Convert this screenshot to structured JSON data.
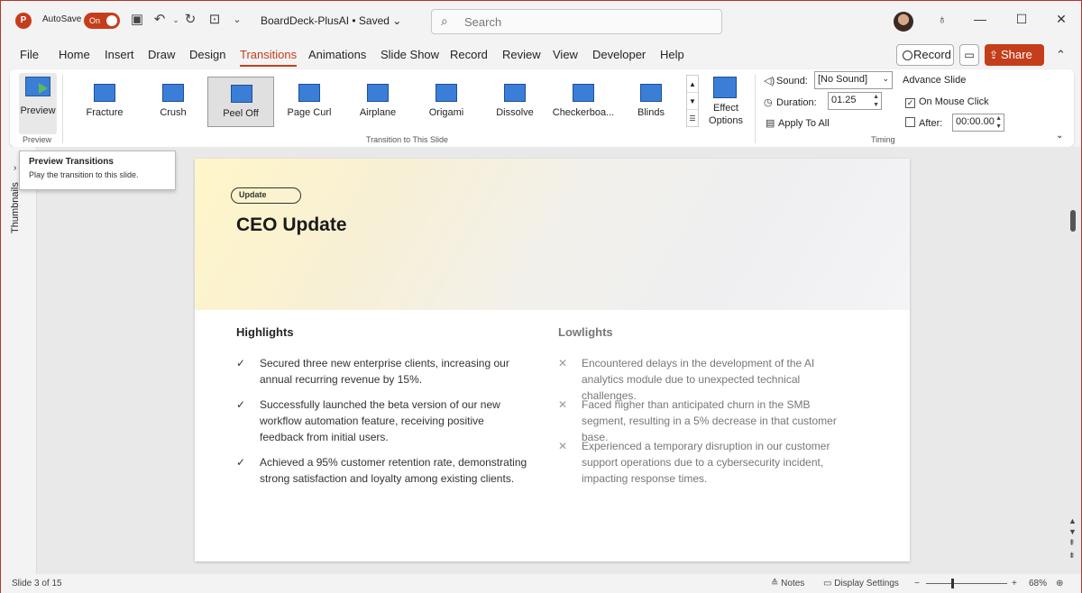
{
  "titlebar": {
    "app_icon": "P",
    "autosave_label": "AutoSave",
    "autosave_state": "On",
    "doc_title": "BoardDeck-PlusAI • Saved ⌄",
    "search_placeholder": "Search",
    "icons": [
      "save-icon",
      "undo-icon",
      "redo-icon",
      "present-icon",
      "customize-icon"
    ]
  },
  "menu": {
    "items": [
      "File",
      "Home",
      "Insert",
      "Draw",
      "Design",
      "Transitions",
      "Animations",
      "Slide Show",
      "Record",
      "Review",
      "View",
      "Developer",
      "Help"
    ],
    "active": "Transitions",
    "record_label": "Record",
    "share_label": "Share"
  },
  "ribbon": {
    "preview_label": "Preview",
    "preview_group": "Preview",
    "transitions_group": "Transition to This Slide",
    "gallery": [
      {
        "label": "Fracture"
      },
      {
        "label": "Crush"
      },
      {
        "label": "Peel Off"
      },
      {
        "label": "Page Curl"
      },
      {
        "label": "Airplane"
      },
      {
        "label": "Origami"
      },
      {
        "label": "Dissolve"
      },
      {
        "label": "Checkerboa..."
      },
      {
        "label": "Blinds"
      }
    ],
    "selected_transition": "Peel Off",
    "effect_options_label": "Effect Options",
    "timing": {
      "sound_label": "Sound:",
      "sound_value": "[No Sound]",
      "duration_label": "Duration:",
      "duration_value": "01.25",
      "apply_all_label": "Apply To All",
      "advance_label": "Advance Slide",
      "mouse_click_label": "On Mouse Click",
      "mouse_click_checked": true,
      "after_label": "After:",
      "after_value": "00:00.00",
      "after_checked": false,
      "group_label": "Timing"
    }
  },
  "tooltip": {
    "title": "Preview Transitions",
    "description": "Play the transition to this slide."
  },
  "thumbnails_label": "Thumbnails",
  "slide": {
    "tag": "Update",
    "title": "CEO Update",
    "highlights_heading": "Highlights",
    "highlights": [
      "Secured three new enterprise clients, increasing our annual recurring revenue by 15%.",
      "Successfully launched the beta version of our new workflow automation feature, receiving positive feedback from initial users.",
      "Achieved a 95% customer retention rate, demonstrating strong satisfaction and loyalty among existing clients."
    ],
    "lowlights_heading": "Lowlights",
    "lowlights": [
      "Encountered delays in the development of the AI analytics module due to unexpected technical challenges.",
      "Faced higher than anticipated churn in the SMB segment, resulting in a 5% decrease in that customer base.",
      "Experienced a temporary disruption in our customer support operations due to a cybersecurity incident, impacting response times."
    ]
  },
  "status": {
    "slide_info": "Slide 3 of 15",
    "notes_label": "Notes",
    "display_label": "Display Settings",
    "zoom": "68%"
  }
}
